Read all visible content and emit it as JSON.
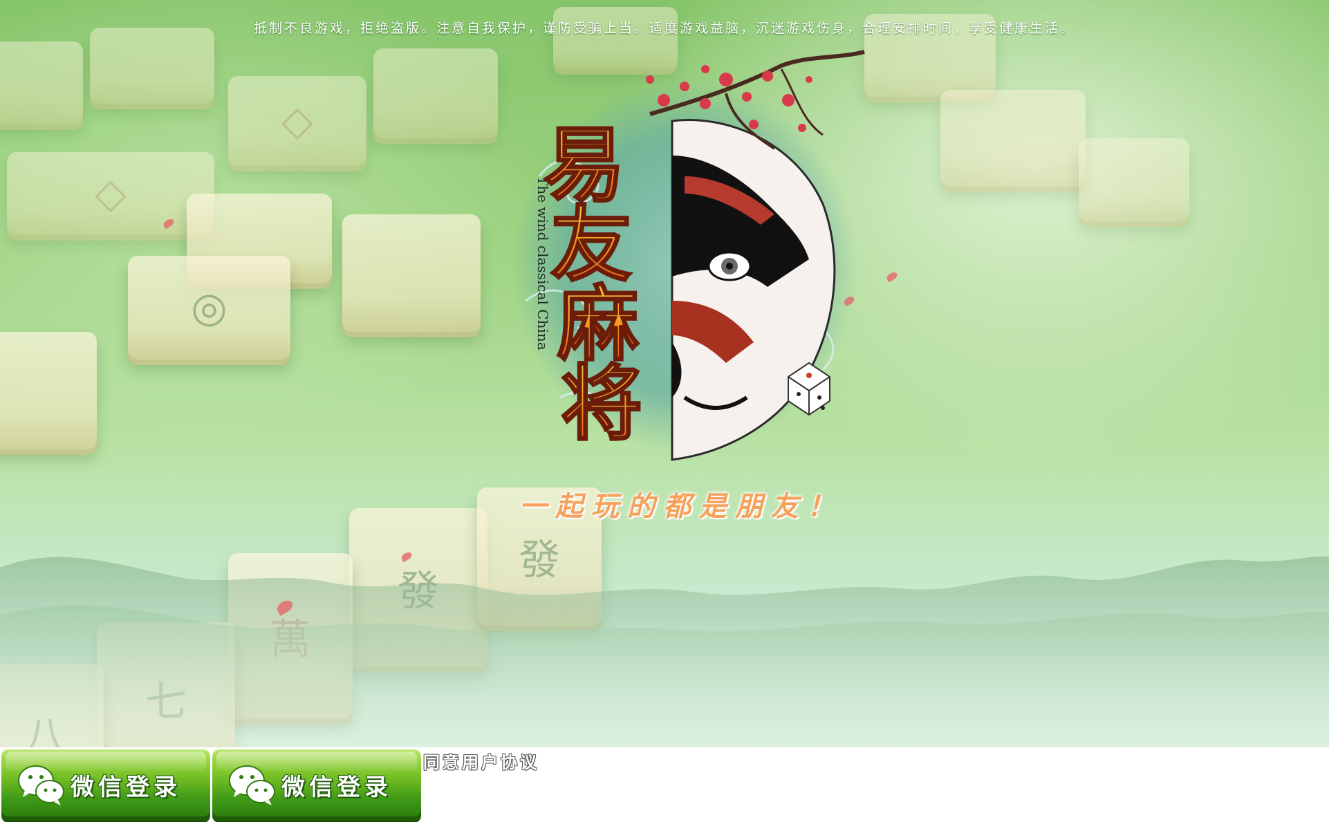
{
  "notice": "抵制不良游戏，拒绝盗版。注意自我保护，谨防受骗上当。适度游戏益脑，沉迷游戏伤身，合理安排时间，享受健康生活。",
  "logo": {
    "title": "易友麻将",
    "subtitle": "The wind classical China",
    "slogan": "一起玩的都是朋友！"
  },
  "buttons": [
    {
      "label": "微信登录",
      "icon": "wechat-icon"
    },
    {
      "label": "微信登录",
      "icon": "wechat-icon"
    }
  ],
  "agreement_label": "同意用户协议",
  "colors": {
    "felt_green": "#8fcb72",
    "button_green": "#4fa81c",
    "title_orange": "#f0861e",
    "slogan_orange": "#f7a25c"
  },
  "tiles": [
    "七",
    "萬",
    "發",
    "八",
    "七",
    "萬"
  ]
}
